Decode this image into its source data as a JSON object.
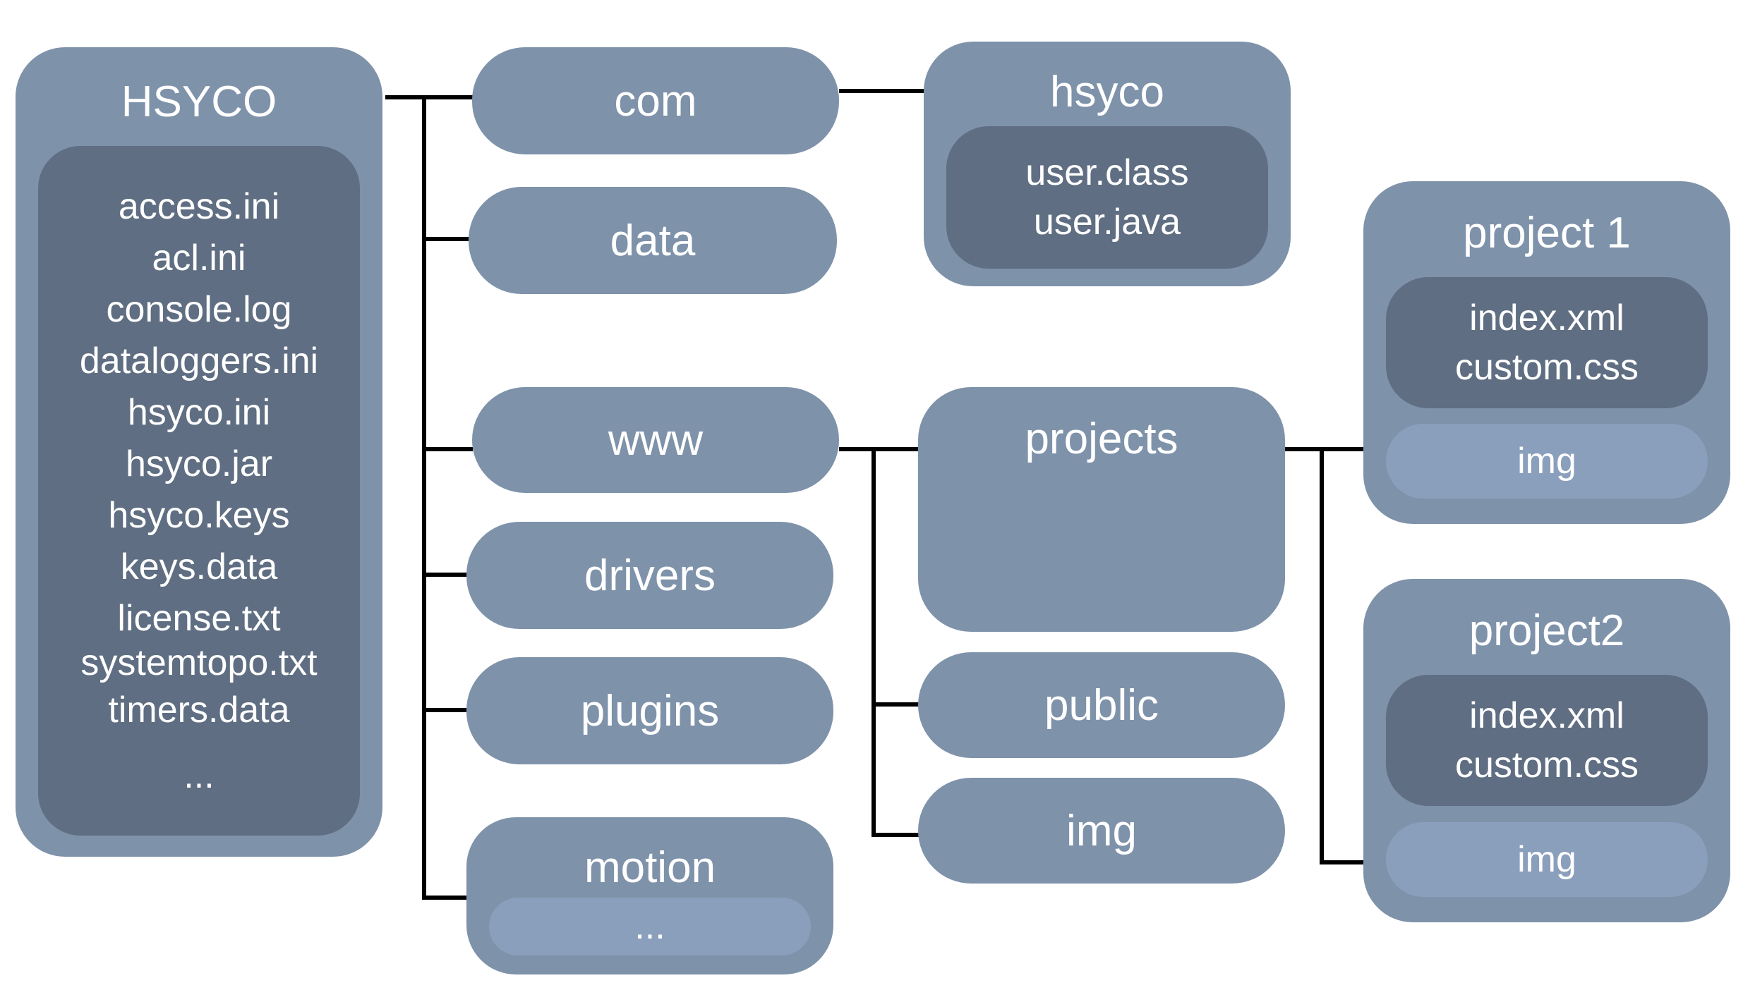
{
  "root": {
    "label": "HSYCO",
    "files": [
      "access.ini",
      "acl.ini",
      "console.log",
      "dataloggers.ini",
      "hsyco.ini",
      "hsyco.jar",
      "hsyco.keys",
      "keys.data",
      "license.txt",
      "systemtopo.txt",
      "timers.data",
      "..."
    ]
  },
  "folders": {
    "com": "com",
    "data": "data",
    "www": "www",
    "drivers": "drivers",
    "plugins": "plugins",
    "motion": {
      "label": "motion",
      "child": "..."
    }
  },
  "hsyco": {
    "label": "hsyco",
    "files": [
      "user.class",
      "user.java"
    ]
  },
  "www_children": {
    "projects": "projects",
    "public": "public",
    "img": "img"
  },
  "projects": [
    {
      "label": "project 1",
      "files": [
        "index.xml",
        "custom.css"
      ],
      "subfolder": "img"
    },
    {
      "label": "project2",
      "files": [
        "index.xml",
        "custom.css"
      ],
      "subfolder": "img"
    }
  ],
  "colors": {
    "folder": "#7e92aa",
    "files": "#5f6e82",
    "subfolder": "#8a9fbc",
    "connector": "#000000"
  }
}
